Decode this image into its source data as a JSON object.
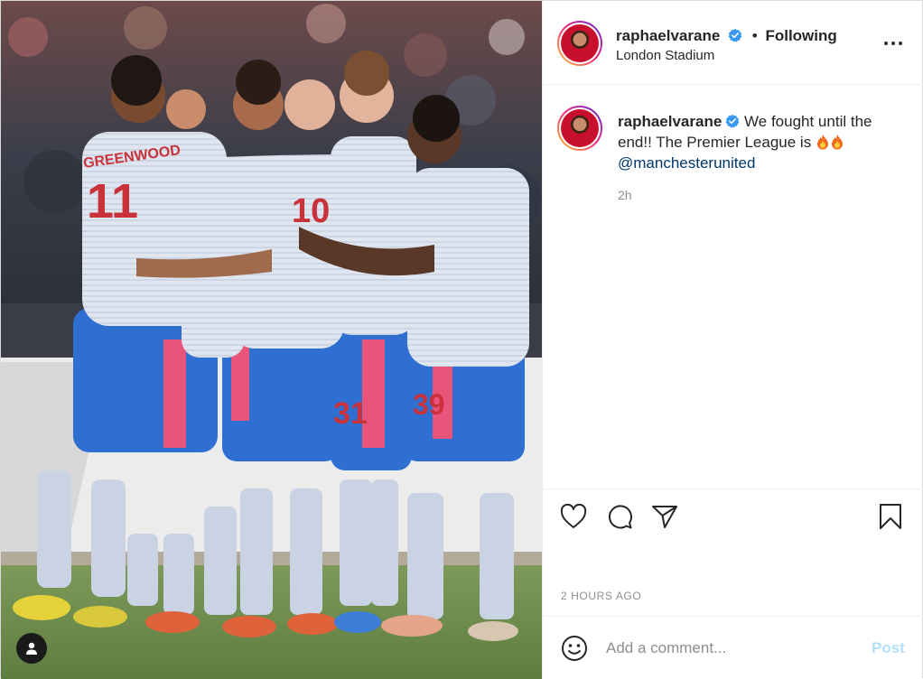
{
  "post": {
    "author": {
      "username": "raphaelvarane",
      "verified": true,
      "follow_status": "Following",
      "location": "London Stadium"
    },
    "caption": {
      "text": "We fought until the end!! The Premier League is",
      "emoji": "🔥🔥",
      "mention": "@manchesterunited",
      "relative_time": "2h"
    },
    "timestamp": "2 HOURS AGO",
    "comment_box": {
      "placeholder": "Add a comment...",
      "post_label": "Post"
    },
    "photo": {
      "jersey_numbers": [
        "11",
        "10",
        "31",
        "39"
      ],
      "jersey_name": "GREENWOOD"
    },
    "icons": {
      "more": "more-options-icon",
      "like": "heart-icon",
      "comment": "comment-icon",
      "share": "share-icon",
      "save": "bookmark-icon",
      "emoji": "emoji-icon",
      "user_tag": "user-tag-icon"
    },
    "colors": {
      "verified_blue": "#3897f0",
      "link": "#00376b",
      "muted": "#8e8e8e",
      "post_disabled": "#b2dffc"
    }
  }
}
